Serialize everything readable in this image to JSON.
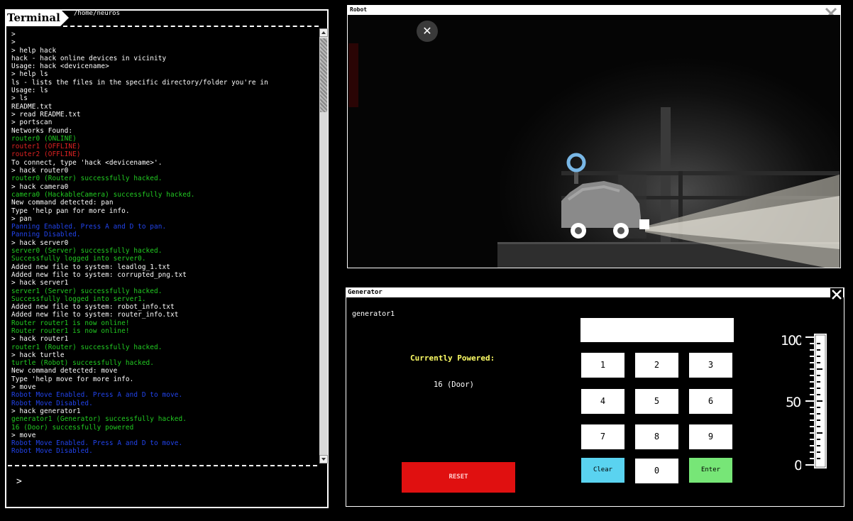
{
  "terminal": {
    "tab_label": "Terminal",
    "path": "/home/neuros",
    "prompt": ">",
    "lines": [
      {
        "t": ">",
        "c": "white"
      },
      {
        "t": ">",
        "c": "white"
      },
      {
        "t": "> help hack",
        "c": "white"
      },
      {
        "t": "hack - hack online devices in vicinity",
        "c": "white"
      },
      {
        "t": "Usage: hack <devicename>",
        "c": "white"
      },
      {
        "t": "> help ls",
        "c": "white"
      },
      {
        "t": "ls - lists the files in the specific directory/folder you're in",
        "c": "white"
      },
      {
        "t": "Usage: ls",
        "c": "white"
      },
      {
        "t": "> ls",
        "c": "white"
      },
      {
        "t": "README.txt",
        "c": "white"
      },
      {
        "t": "> read README.txt",
        "c": "white"
      },
      {
        "t": "> portscan",
        "c": "white"
      },
      {
        "t": "Networks Found:",
        "c": "white"
      },
      {
        "t": "router0 (ONLINE)",
        "c": "green"
      },
      {
        "t": "router1 (OFFLINE)",
        "c": "red"
      },
      {
        "t": "router2 (OFFLINE)",
        "c": "red"
      },
      {
        "t": "To connect, type 'hack <devicename>'.",
        "c": "white"
      },
      {
        "t": "> hack router0",
        "c": "white"
      },
      {
        "t": "router0 (Router) successfully hacked.",
        "c": "green"
      },
      {
        "t": "> hack camera0",
        "c": "white"
      },
      {
        "t": "camera0 (HackableCamera) successfully hacked.",
        "c": "green"
      },
      {
        "t": "New command detected: pan",
        "c": "white"
      },
      {
        "t": "Type 'help pan for more info.",
        "c": "white"
      },
      {
        "t": "> pan",
        "c": "white"
      },
      {
        "t": "Panning Enabled. Press A and D to pan.",
        "c": "blue"
      },
      {
        "t": "Panning Disabled.",
        "c": "blue"
      },
      {
        "t": "> hack server0",
        "c": "white"
      },
      {
        "t": "server0 (Server) successfully hacked.",
        "c": "green"
      },
      {
        "t": "Successfully logged into server0.",
        "c": "green"
      },
      {
        "t": "Added new file to system: leadlog_1.txt",
        "c": "white"
      },
      {
        "t": "Added new file to system: corrupted_png.txt",
        "c": "white"
      },
      {
        "t": "> hack server1",
        "c": "white"
      },
      {
        "t": "server1 (Server) successfully hacked.",
        "c": "green"
      },
      {
        "t": "Successfully logged into server1.",
        "c": "green"
      },
      {
        "t": "Added new file to system: robot_info.txt",
        "c": "white"
      },
      {
        "t": "Added new file to system: router_info.txt",
        "c": "white"
      },
      {
        "t": "Router router1 is now online!",
        "c": "green"
      },
      {
        "t": "Router router1 is now online!",
        "c": "green"
      },
      {
        "t": "> hack router1",
        "c": "white"
      },
      {
        "t": "router1 (Router) successfully hacked.",
        "c": "green"
      },
      {
        "t": "> hack turtle",
        "c": "white"
      },
      {
        "t": "turtle (Robot) successfully hacked.",
        "c": "green"
      },
      {
        "t": "New command detected: move",
        "c": "white"
      },
      {
        "t": "Type 'help move for more info.",
        "c": "white"
      },
      {
        "t": "> move",
        "c": "white"
      },
      {
        "t": "Robot Move Enabled. Press A and D to move.",
        "c": "blue"
      },
      {
        "t": "Robot Move Disabled.",
        "c": "blue"
      },
      {
        "t": "> hack generator1",
        "c": "white"
      },
      {
        "t": "generator1 (Generator) successfully hacked.",
        "c": "green"
      },
      {
        "t": "16 (Door) successfully powered",
        "c": "green"
      },
      {
        "t": "> move",
        "c": "white"
      },
      {
        "t": "Robot Move Enabled. Press A and D to move.",
        "c": "blue"
      },
      {
        "t": "Robot Move Disabled.",
        "c": "blue"
      }
    ]
  },
  "robot": {
    "title": "Robot",
    "close_glyph": "✕"
  },
  "generator": {
    "title": "Generator",
    "name": "generator1",
    "powered_label": "Currently Powered:",
    "powered_value": "16 (Door)",
    "reset_label": "RESET",
    "code_value": "",
    "keys": {
      "k1": "1",
      "k2": "2",
      "k3": "3",
      "k4": "4",
      "k5": "5",
      "k6": "6",
      "k7": "7",
      "k8": "8",
      "k9": "9",
      "clear": "Clear",
      "k0": "0",
      "enter": "Enter"
    },
    "gauge": {
      "labels": {
        "top": "100",
        "mid": "50",
        "bottom": "0"
      },
      "level": 0
    }
  },
  "colors": {
    "green": "#22cc22",
    "red": "#dd2222",
    "blue": "#2244ee",
    "reset": "#e01010",
    "clear": "#5ad3f0",
    "enter": "#77e677",
    "powered_label": "#ffff66"
  }
}
